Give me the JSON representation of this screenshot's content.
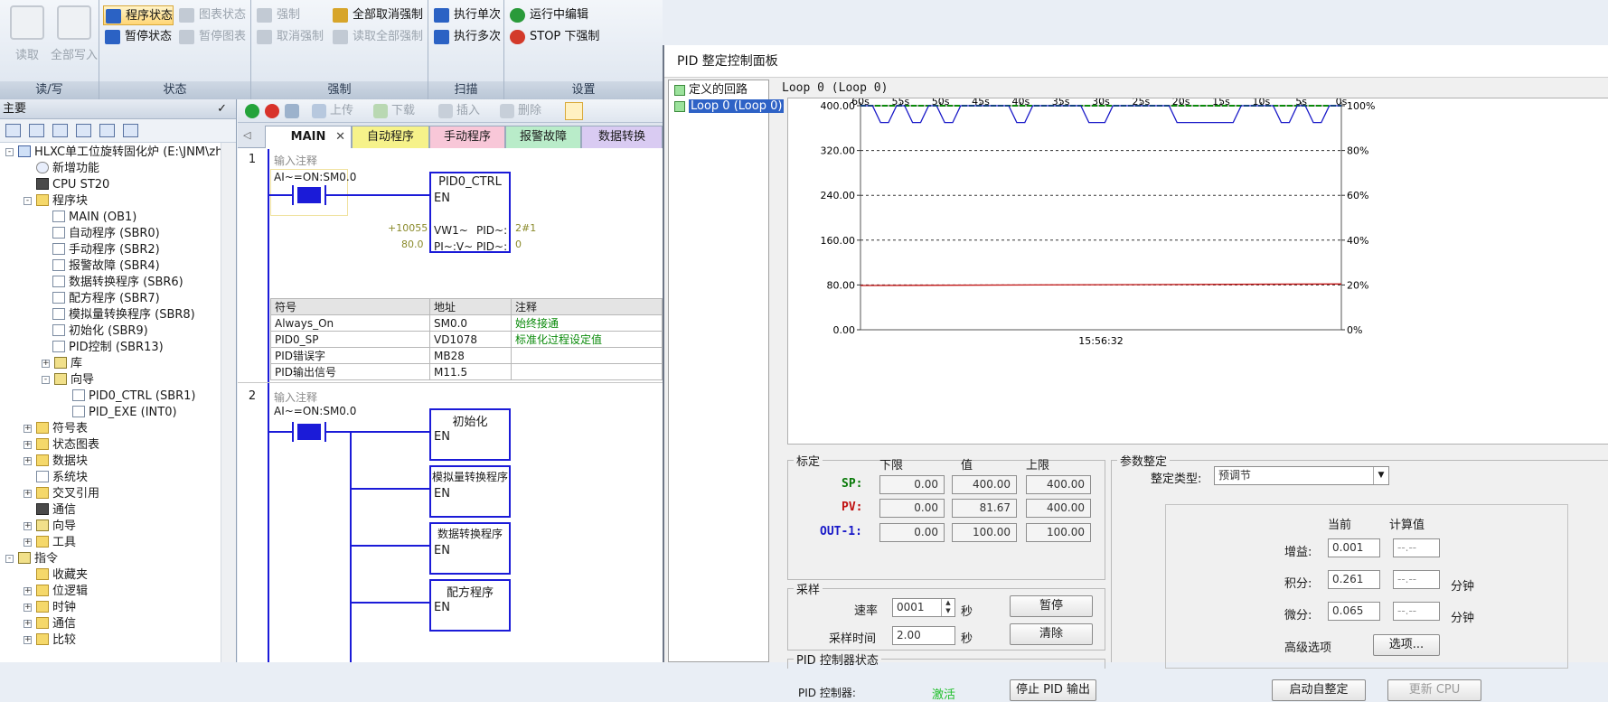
{
  "ribbon": {
    "groups": [
      {
        "title": "读/写",
        "buttons": [
          "读取",
          "全部写入"
        ]
      },
      {
        "title": "状态",
        "buttons": [
          "程序状态",
          "暂停状态",
          "图表状态",
          "暂停图表"
        ]
      },
      {
        "title": "强制",
        "buttons": [
          "强制",
          "全部取消强制",
          "取消强制",
          "读取全部强制"
        ]
      },
      {
        "title": "扫描",
        "buttons": [
          "执行单次",
          "执行多次"
        ]
      },
      {
        "title": "设置",
        "buttons": [
          "运行中编辑",
          "STOP 下强制"
        ]
      }
    ]
  },
  "left": {
    "title": "主要",
    "tree": [
      "HLXC单工位旋转固化炉 (E:\\JNM\\zh",
      "新增功能",
      "CPU ST20",
      "程序块",
      "MAIN (OB1)",
      "自动程序 (SBR0)",
      "手动程序 (SBR2)",
      "报警故障 (SBR4)",
      "数据转换程序 (SBR6)",
      "配方程序 (SBR7)",
      "模拟量转换程序 (SBR8)",
      "初始化 (SBR9)",
      "PID控制 (SBR13)",
      "库",
      "向导",
      "PID0_CTRL (SBR1)",
      "PID_EXE (INT0)",
      "符号表",
      "状态图表",
      "数据块",
      "系统块",
      "交叉引用",
      "通信",
      "向导",
      "工具",
      "指令",
      "收藏夹",
      "位逻辑",
      "时钟",
      "通信",
      "比较"
    ]
  },
  "editor": {
    "toolbar": [
      "上传",
      "下载",
      "插入",
      "删除"
    ],
    "tabs": [
      "MAIN",
      "自动程序",
      "手动程序",
      "报警故障",
      "数据转换"
    ],
    "net1": {
      "num": "1",
      "comment": "输入注释",
      "contact": "AI~=ON:SM0.0",
      "box": "PID0_CTRL",
      "en": "EN",
      "in1_val": "+10055",
      "in1": "VW1~",
      "out1": "PID~:",
      "out1_val": "2#1",
      "in2_val": "80.0",
      "in2": "PI~:V~",
      "out2": "PID~:",
      "out2_val": "0",
      "symtable": {
        "headers": [
          "符号",
          "地址",
          "注释"
        ],
        "rows": [
          [
            "Always_On",
            "SM0.0",
            "始终接通"
          ],
          [
            "PID0_SP",
            "VD1078",
            "标准化过程设定值"
          ],
          [
            "PID错误字",
            "MB28",
            ""
          ],
          [
            "PID输出信号",
            "M11.5",
            ""
          ]
        ]
      }
    },
    "net2": {
      "num": "2",
      "comment": "输入注释",
      "contact": "AI~=ON:SM0.0",
      "boxes": [
        "初始化",
        "模拟量转换程序",
        "数据转换程序",
        "配方程序"
      ],
      "en": "EN"
    }
  },
  "pid": {
    "title": "PID 整定控制面板",
    "tree": [
      "定义的回路",
      "Loop 0 (Loop 0)"
    ],
    "loop_label": "Loop 0 (Loop 0)",
    "time_label": "15:56:32",
    "tuning": {
      "legend": "标定",
      "col_low": "下限",
      "col_val": "值",
      "col_high": "上限",
      "sp": {
        "label": "SP:",
        "low": "0.00",
        "val": "400.00",
        "high": "400.00",
        "color": "#0a7a0a"
      },
      "pv": {
        "label": "PV:",
        "low": "0.00",
        "val": "81.67",
        "high": "400.00",
        "color": "#c01010"
      },
      "out": {
        "label": "OUT-1:",
        "low": "0.00",
        "val": "100.00",
        "high": "100.00",
        "color": "#1a1ac8"
      }
    },
    "sampling": {
      "legend": "采样",
      "rate_label": "速率",
      "rate": "0001",
      "rate_unit": "秒",
      "time_label": "采样时间",
      "time": "2.00",
      "time_unit": "秒",
      "pause": "暂停",
      "clear": "清除"
    },
    "status": {
      "legend": "PID 控制器状态",
      "label": "PID 控制器:",
      "value": "激活",
      "stop": "停止 PID 输出"
    },
    "params": {
      "legend": "参数整定",
      "type_label": "整定类型:",
      "type": "预调节",
      "col_cur": "当前",
      "col_calc": "计算值",
      "gain_label": "增益:",
      "gain": "0.001",
      "gain_calc": "--.--",
      "int_label": "积分:",
      "int": "0.261",
      "int_calc": "--.--",
      "int_unit": "分钟",
      "der_label": "微分:",
      "der": "0.065",
      "der_calc": "--.--",
      "der_unit": "分钟",
      "adv_label": "高级选项",
      "adv_btn": "选项...",
      "start": "启动自整定",
      "update": "更新 CPU"
    }
  },
  "chart_data": {
    "type": "line",
    "x_ticks": [
      "60s",
      "55s",
      "50s",
      "45s",
      "40s",
      "35s",
      "30s",
      "25s",
      "20s",
      "15s",
      "10s",
      "5s",
      "0s"
    ],
    "y_left_ticks": [
      "0.00",
      "80.00",
      "160.00",
      "240.00",
      "320.00",
      "400.00"
    ],
    "y_right_ticks": [
      "0%",
      "20%",
      "40%",
      "60%",
      "80%",
      "100%"
    ],
    "ylim": [
      0,
      400
    ],
    "series": [
      {
        "color": "#0a8a0a",
        "x": [
          60,
          0
        ],
        "y": [
          400,
          400
        ]
      },
      {
        "color": "#c01010",
        "x": [
          60,
          0
        ],
        "y": [
          79,
          81.7
        ]
      },
      {
        "color": "#1a1ac8",
        "x": [
          60,
          58.5,
          57.5,
          56.5,
          55.5,
          54.5,
          53.5,
          52.5,
          51.5,
          50.5,
          49.5,
          48.5,
          47.5,
          41.5,
          40.5,
          39.5,
          38.5,
          32.5,
          31.5,
          29.5,
          28.5,
          21.5,
          20.5,
          13.5,
          12.5,
          8.5,
          7.5,
          6.5,
          5.5,
          4.5,
          3.5,
          2.5,
          1.5,
          0
        ],
        "y": [
          400,
          400,
          370,
          370,
          400,
          400,
          370,
          370,
          400,
          400,
          370,
          370,
          400,
          400,
          370,
          370,
          400,
          400,
          370,
          370,
          400,
          400,
          370,
          370,
          400,
          400,
          370,
          370,
          400,
          400,
          370,
          370,
          400,
          400
        ]
      }
    ]
  }
}
